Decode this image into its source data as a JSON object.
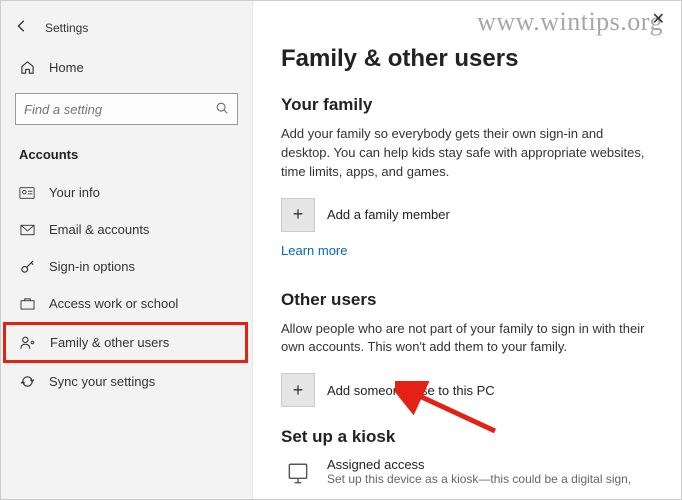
{
  "watermark": "www.wintips.org",
  "window": {
    "title": "Settings"
  },
  "sidebar": {
    "home": "Home",
    "search_placeholder": "Find a setting",
    "section": "Accounts",
    "items": [
      {
        "icon": "user-card",
        "label": "Your info"
      },
      {
        "icon": "email",
        "label": "Email & accounts"
      },
      {
        "icon": "key",
        "label": "Sign-in options"
      },
      {
        "icon": "briefcase",
        "label": "Access work or school"
      },
      {
        "icon": "family",
        "label": "Family & other users"
      },
      {
        "icon": "sync",
        "label": "Sync your settings"
      }
    ]
  },
  "content": {
    "page_title": "Family & other users",
    "family": {
      "heading": "Your family",
      "desc": "Add your family so everybody gets their own sign-in and desktop. You can help kids stay safe with appropriate websites, time limits, apps, and games.",
      "add_label": "Add a family member",
      "link": "Learn more"
    },
    "others": {
      "heading": "Other users",
      "desc": "Allow people who are not part of your family to sign in with their own accounts. This won't add them to your family.",
      "add_label": "Add someone else to this PC"
    },
    "kiosk": {
      "heading": "Set up a kiosk",
      "title": "Assigned access",
      "sub": "Set up this device as a kiosk—this could be a digital sign,"
    }
  }
}
